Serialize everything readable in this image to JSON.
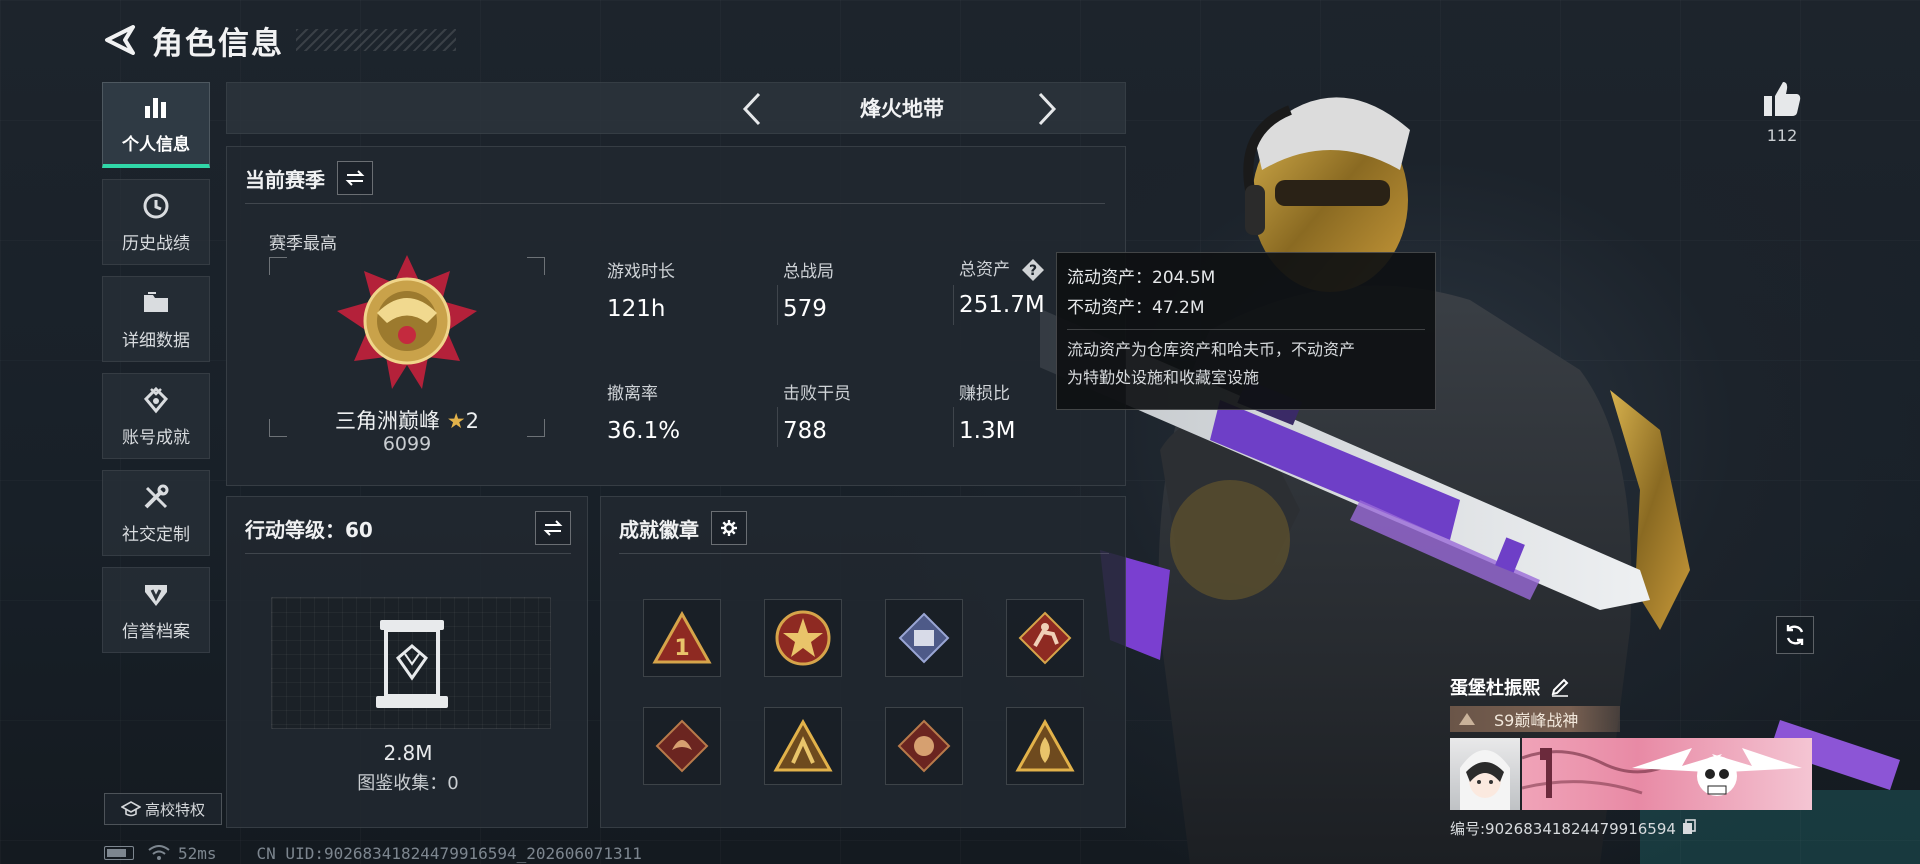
{
  "header": {
    "title": "角色信息"
  },
  "sidebar": {
    "items": [
      {
        "label": "个人信息",
        "icon": "bar-chart-icon",
        "active": true
      },
      {
        "label": "历史战绩",
        "icon": "history-icon",
        "active": false
      },
      {
        "label": "详细数据",
        "icon": "folder-icon",
        "active": false
      },
      {
        "label": "账号成就",
        "icon": "achievement-icon",
        "active": false
      },
      {
        "label": "社交定制",
        "icon": "tools-icon",
        "active": false
      },
      {
        "label": "信誉档案",
        "icon": "credit-icon",
        "active": false
      }
    ],
    "school_button": "高校特权"
  },
  "mode_switcher": {
    "title": "烽火地带"
  },
  "season": {
    "title": "当前赛季",
    "best_label": "赛季最高",
    "rank_name": "三角洲巅峰",
    "rank_stars": "2",
    "rank_score": "6099",
    "stats": [
      {
        "label": "游戏时长",
        "value": "121h"
      },
      {
        "label": "总战局",
        "value": "579"
      },
      {
        "label": "总资产",
        "value": "251.7M"
      },
      {
        "label": "撤离率",
        "value": "36.1%"
      },
      {
        "label": "击败干员",
        "value": "788"
      },
      {
        "label": "赚损比",
        "value": "1.3M"
      }
    ]
  },
  "tooltip": {
    "liquid": "流动资产：204.5M",
    "fixed": "不动资产：47.2M",
    "desc_line1": "流动资产为仓库资产和哈夫币，不动资产",
    "desc_line2": "为特勤处设施和收藏室设施"
  },
  "action_level": {
    "title": "行动等级：60",
    "value": "2.8M",
    "collection": "图鉴收集：0"
  },
  "achievements": {
    "title": "成就徽章",
    "badges": [
      {
        "icon": "rank-one-badge-icon"
      },
      {
        "icon": "star-emblem-badge-icon"
      },
      {
        "icon": "crate-badge-icon"
      },
      {
        "icon": "sprinter-badge-icon"
      },
      {
        "icon": "dragon-badge-icon"
      },
      {
        "icon": "wolf-triangle-badge-icon"
      },
      {
        "icon": "beast-badge-icon"
      },
      {
        "icon": "flame-triangle-badge-icon"
      }
    ]
  },
  "profile": {
    "likes": "112",
    "player_name": "蛋堡杜振熙",
    "title_tag": "S9巅峰战神",
    "player_id": "编号:902683418244799165​94"
  },
  "statusbar": {
    "ping": "52ms",
    "uid": "CN UID:902683418244799165​94_202606071311"
  },
  "colors": {
    "accent": "#30d7a8",
    "gold": "#e2b24a",
    "panel": "#212830"
  }
}
